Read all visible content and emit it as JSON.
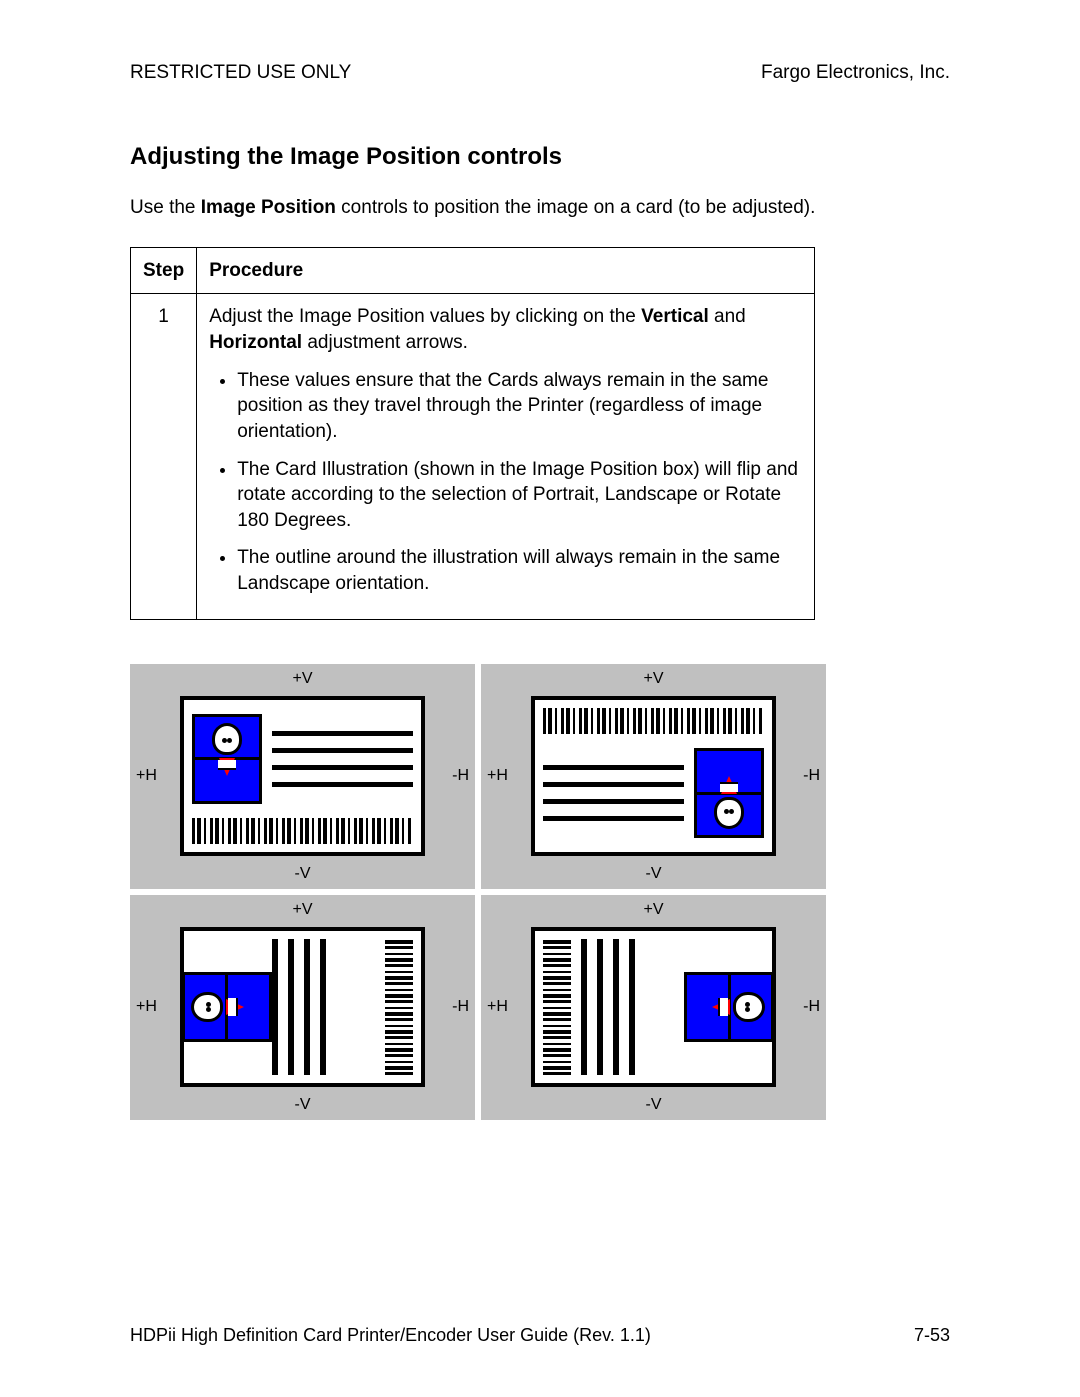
{
  "header": {
    "left": "RESTRICTED USE ONLY",
    "right": "Fargo Electronics, Inc."
  },
  "title": "Adjusting the Image Position controls",
  "intro": {
    "prefix": "Use the ",
    "bold": "Image Position",
    "suffix": " controls to position the image on a card (to be adjusted)."
  },
  "table": {
    "headers": {
      "col1": "Step",
      "col2": "Procedure"
    },
    "row": {
      "step": "1",
      "line1_prefix": "Adjust the Image Position values by clicking on the ",
      "line1_bold1": "Vertical",
      "line1_mid": " and ",
      "line1_bold2": "Horizontal",
      "line1_suffix": " adjustment arrows.",
      "bullets": [
        "These values ensure that the Cards always remain in the same position as they travel through the Printer (regardless of image orientation).",
        "The Card Illustration (shown in the Image Position box) will flip and rotate according to the selection of Portrait, Landscape or Rotate 180 Degrees.",
        "The outline around the illustration will always remain in the same Landscape orientation."
      ]
    }
  },
  "axis_labels": {
    "top": "+V",
    "bottom": "-V",
    "left": "+H",
    "right": "-H"
  },
  "footer": {
    "left": "HDPii High Definition Card Printer/Encoder User Guide (Rev. 1.1)",
    "right": "7-53"
  }
}
